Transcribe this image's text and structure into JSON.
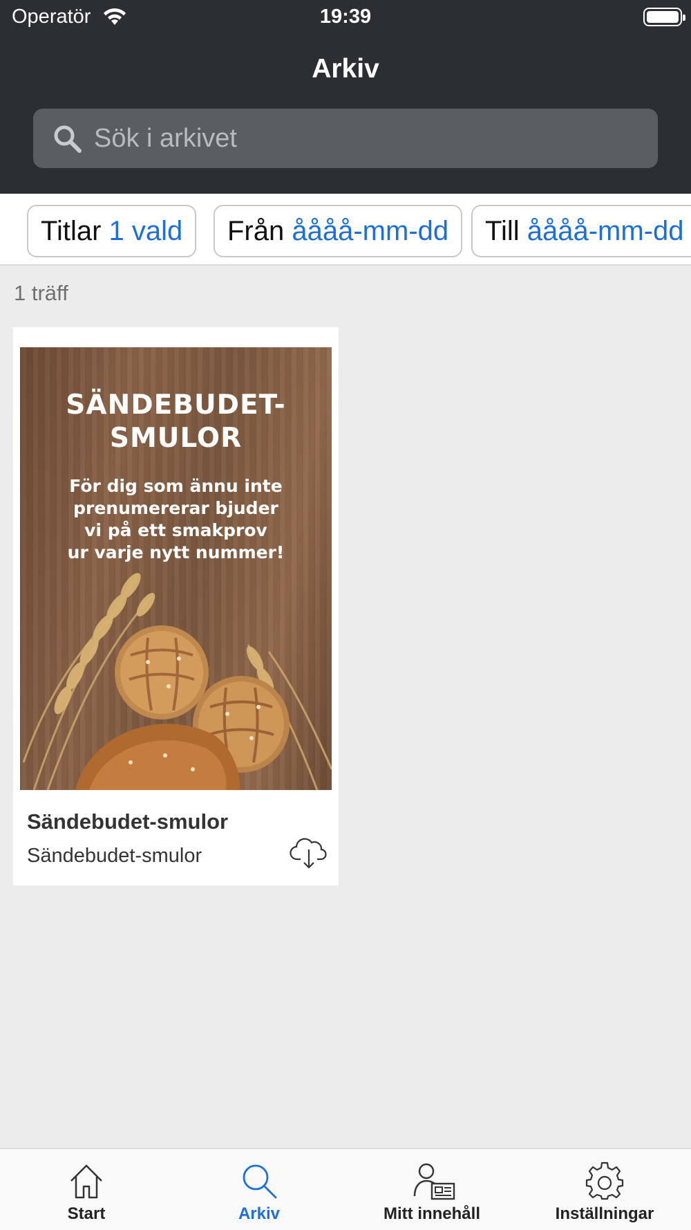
{
  "status_bar": {
    "carrier": "Operatör",
    "time": "19:39"
  },
  "header": {
    "title": "Arkiv"
  },
  "search": {
    "placeholder": "Sök i arkivet"
  },
  "filters": [
    {
      "label": "Titlar",
      "value": "1 vald"
    },
    {
      "label": "Från",
      "value": "åååå-mm-dd"
    },
    {
      "label": "Till",
      "value": "åååå-mm-dd"
    }
  ],
  "results": {
    "count_text": "1 träff",
    "items": [
      {
        "title": "Sändebudet-smulor",
        "subtitle": "Sändebudet-smulor",
        "cover": {
          "headline_line1": "SÄNDEBUDET-",
          "headline_line2": "SMULOR",
          "text_line1": "För dig som ännu inte",
          "text_line2": "prenumererar bjuder",
          "text_line3": "vi på ett smakprov",
          "text_line4": "ur varje nytt nummer!"
        },
        "action_icon": "cloud-download-icon"
      }
    ]
  },
  "tabbar": {
    "active": "Arkiv",
    "accent_color": "#1b6fd8",
    "tabs": [
      {
        "label": "Start",
        "icon": "home-icon"
      },
      {
        "label": "Arkiv",
        "icon": "search-icon"
      },
      {
        "label": "Mitt innehåll",
        "icon": "user-newspaper-icon"
      },
      {
        "label": "Inställningar",
        "icon": "gear-icon"
      }
    ]
  },
  "colors": {
    "header_bg": "#2b2f33",
    "accent": "#1b6fd8",
    "page_bg": "#ececec"
  }
}
